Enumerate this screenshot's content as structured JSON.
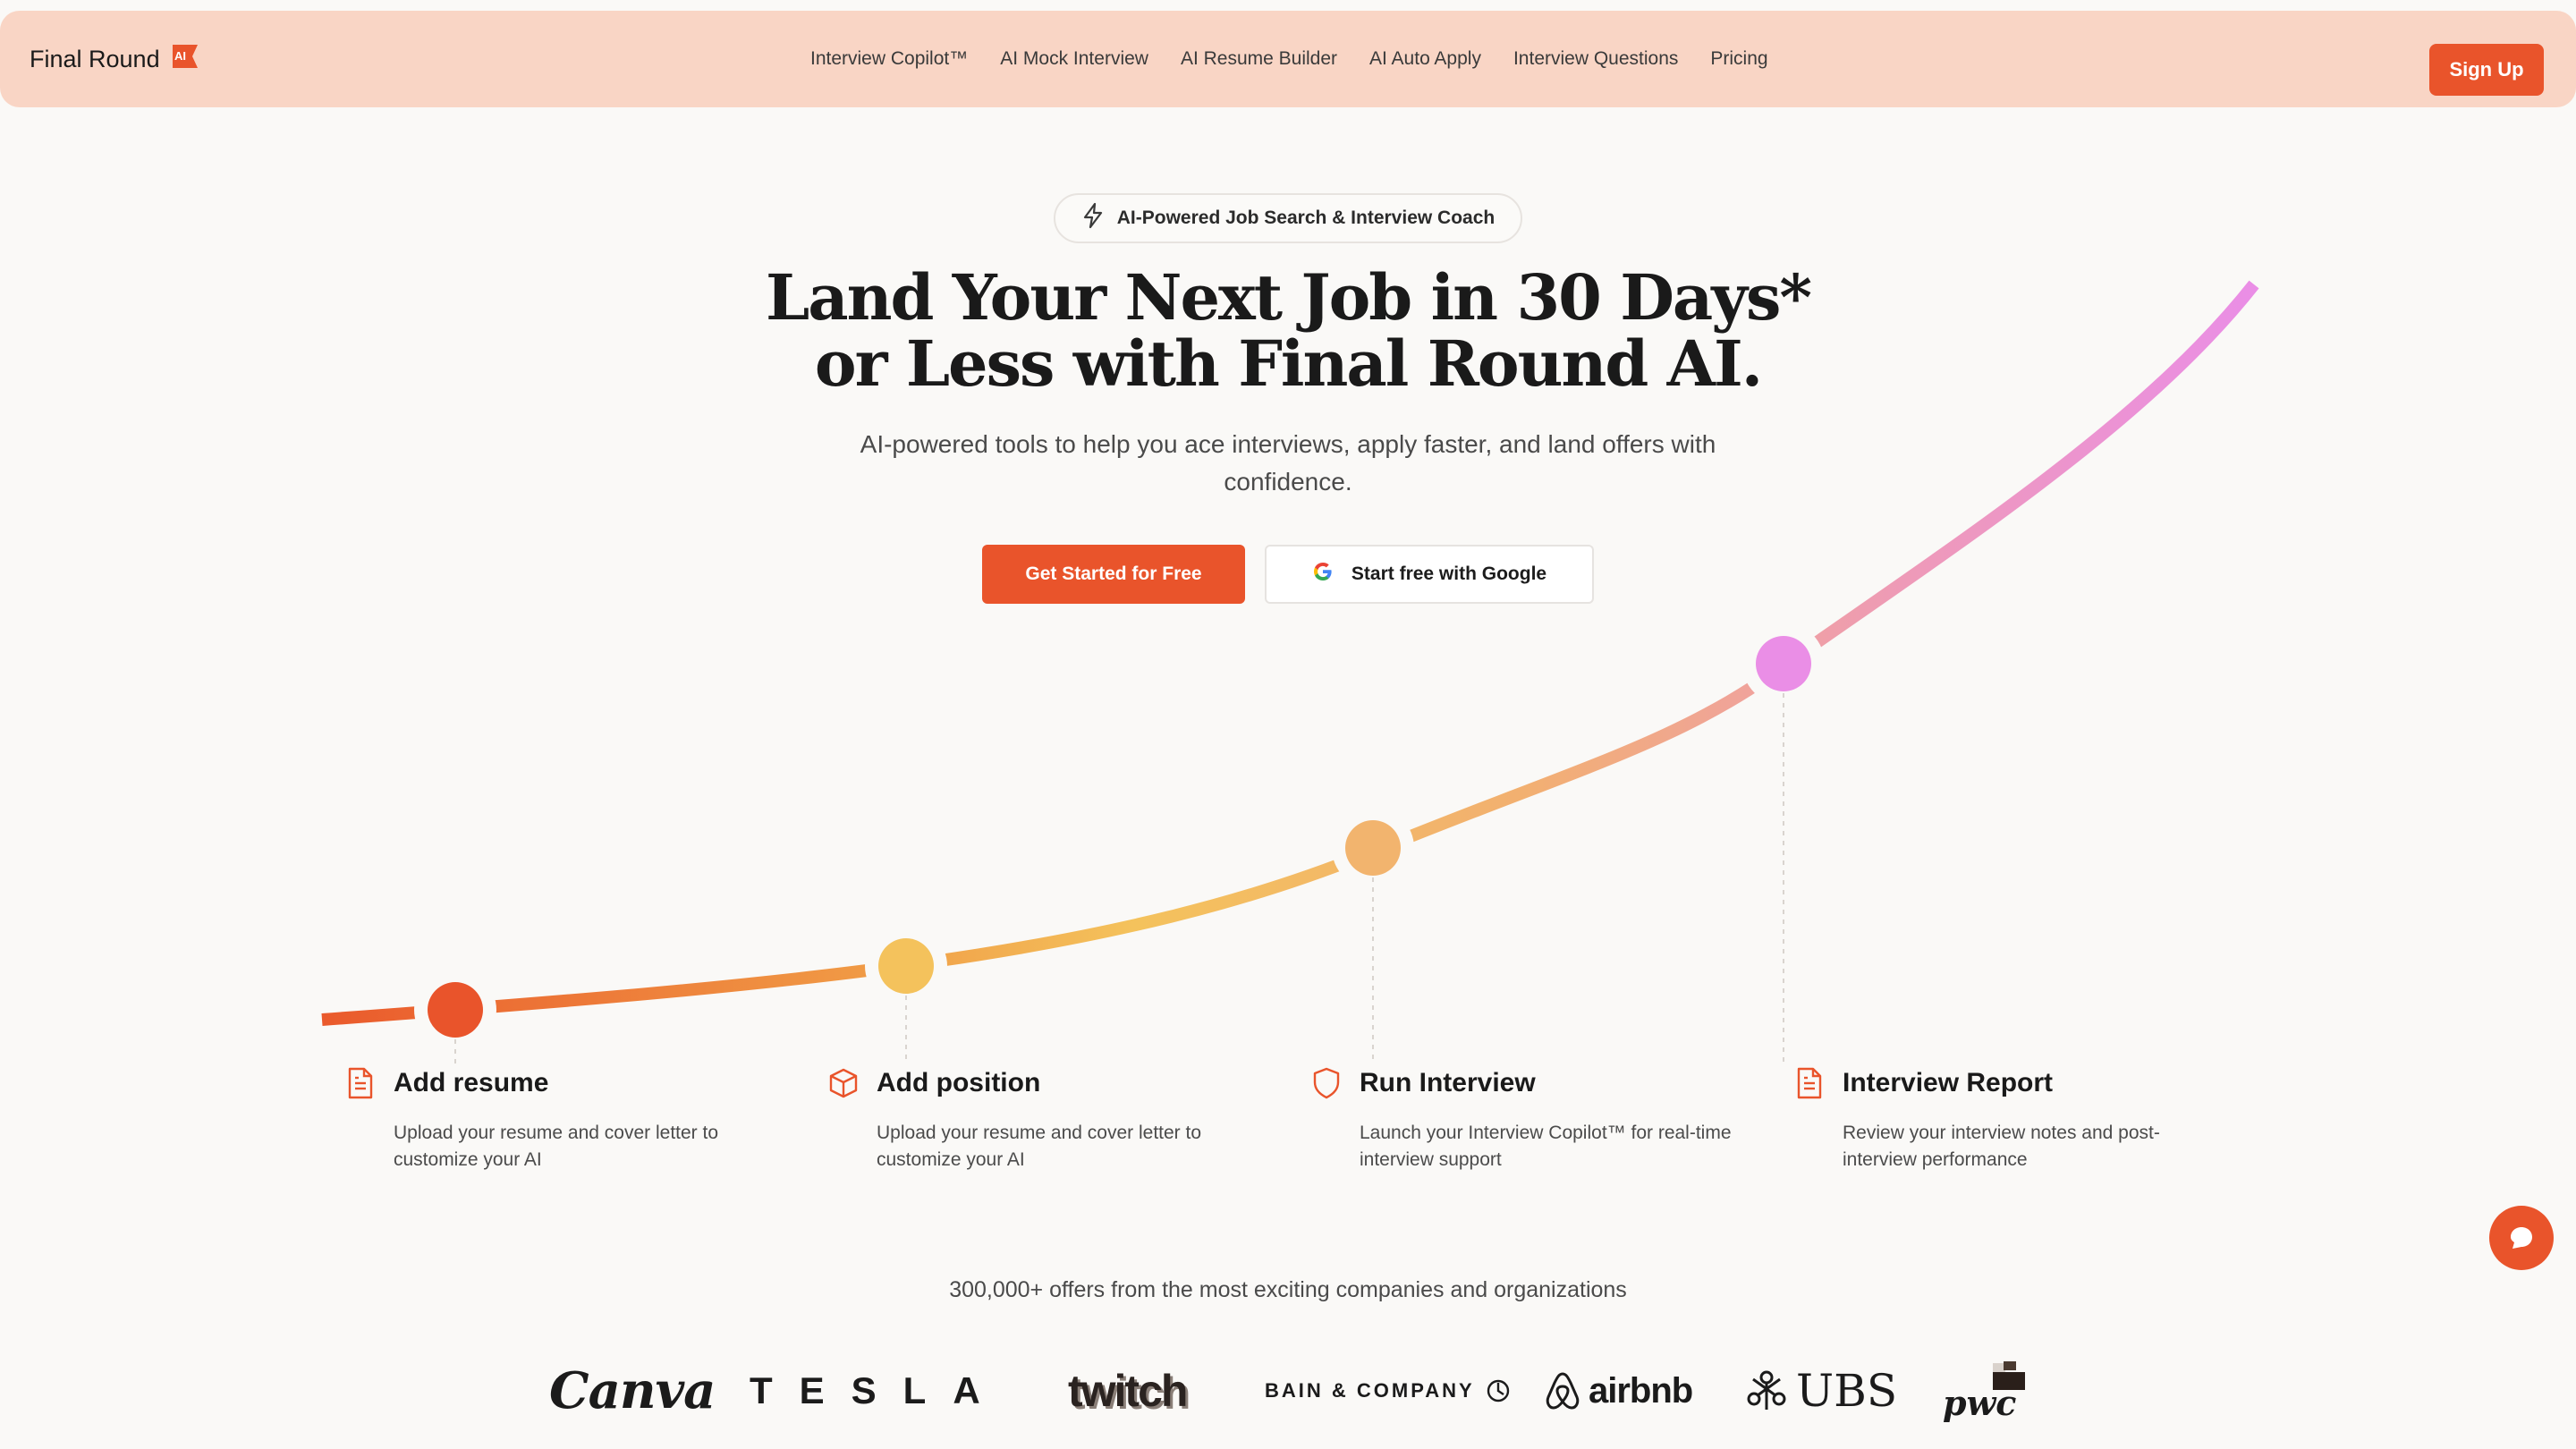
{
  "nav": {
    "brand": "Final Round",
    "brand_badge": "AI",
    "links": [
      "Interview Copilot™",
      "AI Mock Interview",
      "AI Resume Builder",
      "AI Auto Apply",
      "Interview Questions",
      "Pricing"
    ],
    "signup": "Sign Up"
  },
  "hero": {
    "badge": "AI-Powered Job Search & Interview Coach",
    "title_line1": "Land Your Next Job in 30 Days*",
    "title_line2": "or Less with Final Round AI.",
    "subtitle": "AI-powered tools to help you ace interviews, apply faster, and land offers with confidence.",
    "cta_primary": "Get Started for Free",
    "cta_google": "Start free with Google"
  },
  "steps": [
    {
      "title": "Add resume",
      "desc": "Upload your resume and cover letter to customize your AI",
      "icon": "document-icon"
    },
    {
      "title": "Add position",
      "desc": "Upload your resume and cover letter to customize your AI",
      "icon": "cube-icon"
    },
    {
      "title": "Run Interview",
      "desc": "Launch your Interview Copilot™ for real-time interview support",
      "icon": "shield-icon"
    },
    {
      "title": "Interview Report",
      "desc": "Review your interview notes and post-interview performance",
      "icon": "report-icon"
    }
  ],
  "offers": "300,000+ offers from the most exciting companies and organizations",
  "logos": {
    "canva": "Canva",
    "tesla": "TESLA",
    "twitch": "twitch",
    "bain": "BAIN & COMPANY",
    "airbnb": "airbnb",
    "ubs": "UBS",
    "pwc": "pwc"
  },
  "colors": {
    "accent": "#e9542b",
    "nav_bg": "#f9d5c5",
    "dot1": "#e9542b",
    "dot2": "#f4c25c",
    "dot3": "#f2b46e",
    "dot4": "#ea8ee6"
  }
}
